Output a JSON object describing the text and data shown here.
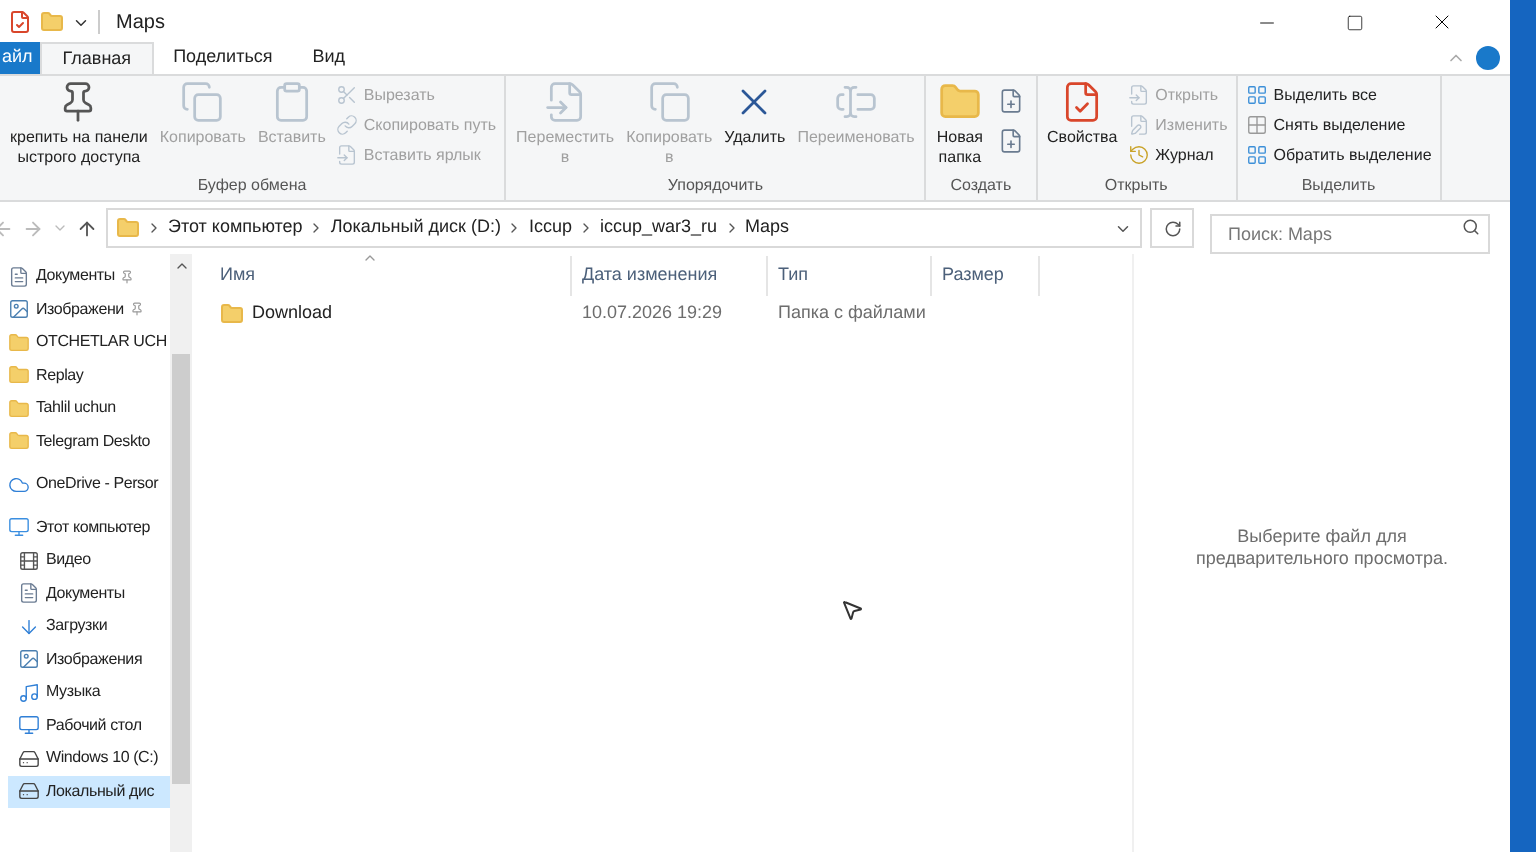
{
  "window": {
    "title": "Maps"
  },
  "tabs": [
    {
      "label": "айл",
      "kind": "file",
      "selected": false
    },
    {
      "label": "Главная",
      "kind": "tab",
      "selected": true
    },
    {
      "label": "Поделиться",
      "kind": "tab",
      "selected": false
    },
    {
      "label": "Вид",
      "kind": "tab",
      "selected": false
    }
  ],
  "ribbon": [
    {
      "group": "Буфер обмена",
      "items": [
        {
          "kind": "big",
          "label": "крепить на панели\nыстрого доступа",
          "disabled": false
        },
        {
          "kind": "big",
          "label": "Копировать",
          "disabled": true
        },
        {
          "kind": "big",
          "label": "Вставить",
          "disabled": true
        },
        {
          "kind": "small",
          "label": "Вырезать",
          "disabled": true
        },
        {
          "kind": "small",
          "label": "Скопировать путь",
          "disabled": true
        },
        {
          "kind": "small",
          "label": "Вставить ярлык",
          "disabled": true
        }
      ]
    },
    {
      "group": "Упорядочить",
      "items": [
        {
          "kind": "big",
          "label": "Переместить\nв",
          "disabled": true
        },
        {
          "kind": "big",
          "label": "Копировать\nв",
          "disabled": true
        },
        {
          "kind": "big",
          "label": "Удалить",
          "disabled": false
        },
        {
          "kind": "big",
          "label": "Переименовать",
          "disabled": true
        }
      ]
    },
    {
      "group": "Создать",
      "items": [
        {
          "kind": "big",
          "label": "Новая\nпапка",
          "disabled": false
        },
        {
          "kind": "tiny",
          "disabled": false
        },
        {
          "kind": "tiny",
          "disabled": false
        }
      ]
    },
    {
      "group": "Открыть",
      "items": [
        {
          "kind": "big",
          "label": "Свойства",
          "disabled": false
        },
        {
          "kind": "small",
          "label": "Открыть",
          "disabled": true
        },
        {
          "kind": "small",
          "label": "Изменить",
          "disabled": true
        },
        {
          "kind": "small",
          "label": "Журнал",
          "disabled": false
        }
      ]
    },
    {
      "group": "Выделить",
      "items": [
        {
          "kind": "small",
          "label": "Выделить все",
          "disabled": false
        },
        {
          "kind": "small",
          "label": "Снять выделение",
          "disabled": false
        },
        {
          "kind": "small",
          "label": "Обратить выделение",
          "disabled": false
        }
      ]
    }
  ],
  "address": {
    "path": [
      "Этот компьютер",
      "Локальный диск (D:)",
      "Iccup",
      "iccup_war3_ru",
      "Maps"
    ]
  },
  "search": {
    "placeholder": "Поиск: Maps"
  },
  "sidebar": {
    "items": [
      {
        "label": "Документы",
        "kind": "documents",
        "pinned": true,
        "selected": false
      },
      {
        "label": "Изображени",
        "kind": "images",
        "pinned": true,
        "selected": false
      },
      {
        "label": "OTCHETLAR UCH",
        "kind": "folder",
        "pinned": false,
        "selected": false
      },
      {
        "label": "Replay",
        "kind": "folder",
        "pinned": false,
        "selected": false
      },
      {
        "label": "Tahlil uchun",
        "kind": "folder",
        "pinned": false,
        "selected": false
      },
      {
        "label": "Telegram Deskto",
        "kind": "folder",
        "pinned": false,
        "selected": false
      },
      {
        "label": "OneDrive - Persor",
        "kind": "cloud",
        "selected": false
      },
      {
        "label": "Этот компьютер",
        "kind": "computer",
        "selected": false,
        "children": [
          {
            "label": "Видео",
            "kind": "video",
            "selected": false
          },
          {
            "label": "Документы",
            "kind": "documents",
            "selected": false
          },
          {
            "label": "Загрузки",
            "kind": "downloads",
            "selected": false
          },
          {
            "label": "Изображения",
            "kind": "images",
            "selected": false
          },
          {
            "label": "Музыка",
            "kind": "music",
            "selected": false
          },
          {
            "label": "Рабочий стол",
            "kind": "desktop",
            "selected": false
          },
          {
            "label": "Windows 10 (C:)",
            "kind": "drive",
            "selected": false
          },
          {
            "label": "Локальный дис",
            "kind": "drive",
            "selected": true
          }
        ]
      }
    ]
  },
  "table": {
    "columns": [
      {
        "label": "Имя",
        "sorted": true
      },
      {
        "label": "Дата изменения",
        "sorted": false
      },
      {
        "label": "Тип",
        "sorted": false
      },
      {
        "label": "Размер",
        "sorted": false
      }
    ],
    "rows": [
      {
        "name": "Download",
        "date": "10.07.2026 19:29",
        "type": "Папка с файлами"
      }
    ]
  },
  "preview": {
    "message": "Выберите файл для предварительного просмотра."
  }
}
